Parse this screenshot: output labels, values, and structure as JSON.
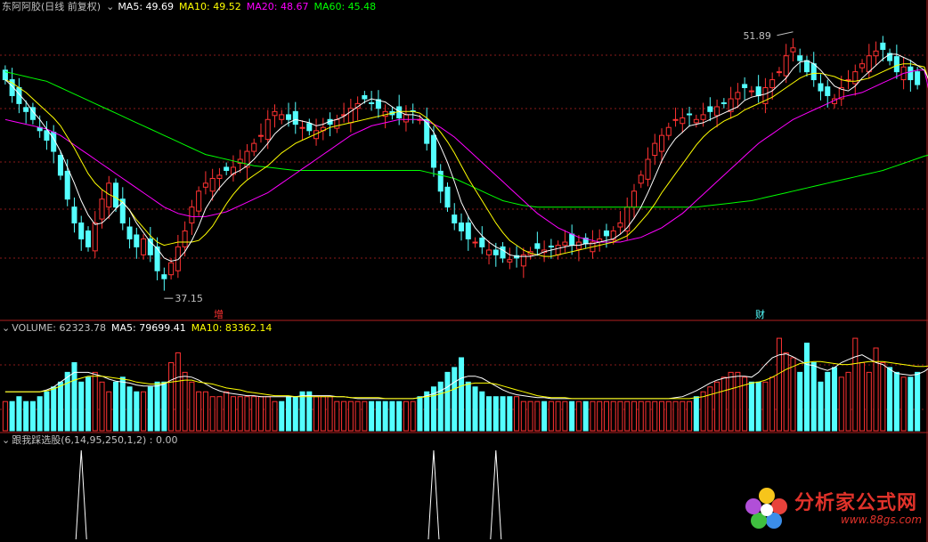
{
  "colors": {
    "up": "#ff3232",
    "down": "#54ffff",
    "ma5": "#ffffff",
    "ma10": "#ffff00",
    "ma20": "#ff00ff",
    "ma60": "#00ff00",
    "grid": "#8a1a1a",
    "divider": "#b02020",
    "text": "#c0c0c0"
  },
  "price_header": {
    "toggle_icon": "circle-chevron-icon",
    "title": "东阿阿胶(日线 前复权)",
    "ma5": "MA5: 49.69",
    "ma10": "MA10: 49.52",
    "ma20": "MA20: 48.67",
    "ma60": "MA60: 45.48"
  },
  "volume_header": {
    "toggle_icon": "circle-chevron-icon",
    "title": "VOLUME: 62323.78",
    "ma5": "MA5: 79699.41",
    "ma10": "MA10: 83362.14"
  },
  "indicator_header": {
    "toggle_icon": "circle-chevron-icon",
    "title": "跟我踩选股(6,14,95,250,1,2) : 0.00"
  },
  "markers": {
    "zeng": "增",
    "cai": "财"
  },
  "watermark": {
    "text": "分析家公式网",
    "url": "www.88gs.com"
  },
  "chart_data": [
    {
      "type": "candlestick",
      "title": "东阿阿胶(日线 前复权)",
      "annotations": [
        {
          "label": "37.15",
          "kind": "low"
        },
        {
          "label": "51.89",
          "kind": "high"
        }
      ],
      "ylim": [
        36,
        54
      ],
      "close": [
        50,
        49,
        48.5,
        48,
        47.5,
        46.8,
        46.2,
        45.5,
        44,
        42.5,
        41,
        40,
        39.5,
        41,
        42.5,
        43.5,
        42,
        41,
        40,
        39.5,
        40,
        39,
        38,
        37.5,
        38.5,
        39.5,
        40.5,
        42,
        43,
        43.5,
        43.8,
        44,
        44.3,
        44.5,
        45,
        45.5,
        46,
        46.5,
        47.5,
        48,
        47.8,
        47.5,
        47.2,
        47,
        46.8,
        46.8,
        47,
        47.2,
        47.5,
        47.8,
        48.2,
        48.5,
        48.8,
        48.5,
        48.2,
        48,
        47.8,
        47.6,
        47.8,
        48,
        47.5,
        46,
        44.5,
        43,
        42,
        41,
        40.5,
        40,
        39.8,
        39.5,
        39.3,
        39,
        38.8,
        38.7,
        38.8,
        39,
        39.2,
        39.4,
        39.3,
        39.5,
        39.6,
        39.8,
        39.6,
        39.8,
        39.7,
        39.8,
        40,
        40.2,
        40.5,
        41,
        42,
        43,
        44,
        45,
        46,
        46.5,
        47,
        47.5,
        47.6,
        47.8,
        47.5,
        47.8,
        48,
        48.3,
        48.5,
        48.8,
        49.2,
        49.5,
        49.3,
        49,
        49.5,
        50,
        50.5,
        51.5,
        52,
        51.2,
        50.5,
        50,
        49.3,
        49,
        48.8,
        49.5,
        50,
        50.5,
        51,
        51.5,
        51.8,
        51.9,
        51.2,
        50.5,
        50.8,
        50,
        49.69
      ],
      "ma5": [
        50,
        49.6,
        49.1,
        48.6,
        48,
        47.5,
        46.9,
        46.3,
        45.5,
        44.5,
        43.5,
        42.4,
        41.5,
        40.9,
        41,
        41.4,
        41.9,
        42.3,
        41.8,
        41,
        40.4,
        39.8,
        39.4,
        38.8,
        38.6,
        38.7,
        39.2,
        39.9,
        40.8,
        41.9,
        42.6,
        43.2,
        43.7,
        44.1,
        44.3,
        44.6,
        45,
        45.5,
        46,
        46.6,
        47,
        47.3,
        47.5,
        47.4,
        47.3,
        47.1,
        47.2,
        47.4,
        47.5,
        47.7,
        48,
        48.3,
        48.6,
        48.8,
        48.7,
        48.6,
        48.3,
        48,
        47.8,
        47.8,
        47.7,
        47.3,
        46.7,
        45.8,
        44.8,
        43.6,
        42.3,
        41.4,
        40.7,
        40.2,
        39.8,
        39.5,
        39.3,
        39,
        38.9,
        38.9,
        38.9,
        39,
        39.2,
        39.3,
        39.4,
        39.5,
        39.6,
        39.6,
        39.7,
        39.7,
        39.8,
        39.9,
        40,
        40.3,
        40.7,
        41.3,
        42,
        42.9,
        43.9,
        44.9,
        45.7,
        46.3,
        46.7,
        47.1,
        47.2,
        47.3,
        47.5,
        47.7,
        47.9,
        48.1,
        48.3,
        48.7,
        48.9,
        49,
        49.1,
        49.3,
        49.7,
        50.1,
        50.7,
        51.1,
        51.2,
        51,
        50.6,
        50.1,
        49.6,
        49.4,
        49.3,
        49.6,
        50.1,
        50.5,
        50.9,
        51.3,
        51.6,
        51.6,
        51.4,
        51.2,
        50.9,
        50.6,
        49.69
      ],
      "ma10": [
        50,
        49.8,
        49.5,
        49.2,
        48.8,
        48.4,
        48,
        47.6,
        47.1,
        46.4,
        45.7,
        44.9,
        44.1,
        43.5,
        43.1,
        42.8,
        42.6,
        42.3,
        41.8,
        41.2,
        40.7,
        40.2,
        39.8,
        39.6,
        39.7,
        39.8,
        39.8,
        39.8,
        39.9,
        40.3,
        40.8,
        41.5,
        42.2,
        42.8,
        43.3,
        43.7,
        44,
        44.3,
        44.6,
        45,
        45.4,
        45.7,
        46,
        46.2,
        46.4,
        46.6,
        46.8,
        47,
        47.1,
        47.2,
        47.3,
        47.4,
        47.5,
        47.6,
        47.7,
        47.8,
        47.9,
        48,
        48,
        48,
        47.9,
        47.6,
        47.2,
        46.7,
        46.1,
        45.4,
        44.6,
        43.8,
        43.1,
        42.4,
        41.7,
        41,
        40.4,
        39.9,
        39.6,
        39.3,
        39.1,
        39,
        38.9,
        38.9,
        39,
        39.1,
        39.2,
        39.3,
        39.4,
        39.5,
        39.6,
        39.7,
        39.8,
        40,
        40.2,
        40.6,
        41.1,
        41.6,
        42.2,
        42.9,
        43.5,
        44.1,
        44.7,
        45.3,
        45.9,
        46.4,
        46.8,
        47.1,
        47.4,
        47.6,
        47.8,
        48.1,
        48.3,
        48.5,
        48.7,
        48.9,
        49.2,
        49.5,
        49.8,
        50.1,
        50.3,
        50.4,
        50.4,
        50.3,
        50.2,
        50,
        49.9,
        49.9,
        50,
        50.1,
        50.3,
        50.5,
        50.7,
        50.9,
        51,
        51,
        50.9,
        50.8,
        49.52
      ],
      "ma20": [
        47.5,
        47.4,
        47.3,
        47.2,
        47.1,
        47,
        46.9,
        46.7,
        46.5,
        46.2,
        45.9,
        45.6,
        45.3,
        45,
        44.7,
        44.4,
        44.1,
        43.8,
        43.5,
        43.2,
        42.9,
        42.6,
        42.3,
        42,
        41.8,
        41.6,
        41.5,
        41.4,
        41.4,
        41.4,
        41.5,
        41.6,
        41.7,
        41.9,
        42.1,
        42.3,
        42.5,
        42.7,
        42.9,
        43.2,
        43.5,
        43.8,
        44.1,
        44.4,
        44.7,
        45,
        45.3,
        45.6,
        45.9,
        46.2,
        46.5,
        46.7,
        46.9,
        47.1,
        47.2,
        47.3,
        47.4,
        47.5,
        47.5,
        47.5,
        47.5,
        47.4,
        47.2,
        47,
        46.7,
        46.4,
        46,
        45.6,
        45.2,
        44.8,
        44.4,
        44,
        43.6,
        43.2,
        42.8,
        42.4,
        42,
        41.6,
        41.3,
        41,
        40.7,
        40.5,
        40.3,
        40.1,
        40,
        39.9,
        39.8,
        39.8,
        39.8,
        39.8,
        39.9,
        40,
        40.1,
        40.3,
        40.5,
        40.7,
        41,
        41.3,
        41.6,
        42,
        42.4,
        42.8,
        43.2,
        43.6,
        44,
        44.4,
        44.8,
        45.2,
        45.6,
        46,
        46.3,
        46.6,
        46.9,
        47.2,
        47.5,
        47.7,
        47.9,
        48.1,
        48.3,
        48.5,
        48.7,
        48.9,
        49,
        49.1,
        49.2,
        49.4,
        49.6,
        49.8,
        50,
        50.2,
        50.4,
        50.5,
        50.6,
        50.6,
        48.67
      ],
      "ma60": [
        50.5,
        50.4,
        50.3,
        50.2,
        50.1,
        50,
        49.9,
        49.7,
        49.5,
        49.3,
        49.1,
        48.9,
        48.7,
        48.5,
        48.3,
        48.1,
        47.9,
        47.7,
        47.5,
        47.3,
        47.1,
        46.9,
        46.7,
        46.5,
        46.3,
        46.1,
        45.9,
        45.7,
        45.5,
        45.3,
        45.2,
        45.1,
        45,
        44.9,
        44.8,
        44.7,
        44.6,
        44.55,
        44.5,
        44.45,
        44.4,
        44.35,
        44.3,
        44.3,
        44.3,
        44.3,
        44.3,
        44.3,
        44.3,
        44.3,
        44.3,
        44.3,
        44.3,
        44.3,
        44.3,
        44.3,
        44.3,
        44.3,
        44.3,
        44.3,
        44.3,
        44.2,
        44.1,
        44,
        43.9,
        43.8,
        43.6,
        43.4,
        43.2,
        43,
        42.8,
        42.6,
        42.4,
        42.3,
        42.2,
        42.1,
        42.05,
        42,
        42,
        42,
        42,
        42,
        42,
        42,
        42,
        42,
        42,
        42,
        42,
        42,
        42,
        42,
        42,
        42,
        42,
        42,
        42,
        42,
        42,
        42,
        42,
        42.05,
        42.1,
        42.15,
        42.2,
        42.25,
        42.3,
        42.35,
        42.4,
        42.5,
        42.6,
        42.7,
        42.8,
        42.9,
        43,
        43.1,
        43.2,
        43.3,
        43.4,
        43.5,
        43.6,
        43.7,
        43.8,
        43.9,
        44,
        44.1,
        44.2,
        44.3,
        44.45,
        44.6,
        44.75,
        44.9,
        45.05,
        45.2,
        45.3,
        45.4,
        45.48
      ]
    },
    {
      "type": "bar",
      "title": "VOLUME: 62323.78",
      "volume": [
        3,
        3,
        3.5,
        3,
        3,
        3.5,
        4,
        4.5,
        5,
        6,
        7,
        5,
        5.5,
        6,
        5,
        4,
        5,
        5.5,
        4.5,
        4,
        4,
        4.5,
        5,
        5,
        7,
        8,
        6,
        5,
        4,
        4,
        3.5,
        3.5,
        4,
        3.5,
        3.5,
        3.5,
        3.5,
        3.5,
        3.5,
        3,
        3,
        3.5,
        3.5,
        4,
        4,
        3.5,
        3.5,
        3.5,
        3,
        3,
        3,
        3,
        3,
        3,
        3,
        3,
        3,
        3,
        3,
        3,
        3.5,
        4,
        4.5,
        5,
        6,
        6.5,
        7.5,
        5,
        4.5,
        4,
        3.5,
        3.5,
        3.5,
        3.5,
        3.5,
        3,
        3,
        3,
        3,
        3,
        3,
        3,
        3,
        3,
        3,
        3,
        3,
        3,
        3,
        3,
        3,
        3,
        3,
        3,
        3,
        3,
        3,
        3,
        3,
        3,
        3.5,
        4,
        4.5,
        5,
        5.5,
        6,
        6,
        5.5,
        5,
        5,
        5,
        5.5,
        9.5,
        8,
        7.5,
        6,
        9,
        7,
        5,
        6,
        6.5,
        5.5,
        6,
        9.5,
        7,
        6,
        8.5,
        7,
        6.5,
        6,
        5.5,
        5.5,
        6,
        5.5,
        5.5,
        6,
        5.5,
        8,
        9,
        8.5,
        7,
        6.5
      ],
      "ma5": [
        4,
        4,
        4,
        4,
        4,
        4,
        4.2,
        4.5,
        5,
        5.5,
        6,
        6,
        6,
        5.8,
        5.6,
        5.3,
        5.1,
        5,
        4.9,
        4.7,
        4.6,
        4.6,
        4.6,
        4.8,
        5.2,
        5.5,
        5.6,
        5.5,
        5.2,
        4.8,
        4.4,
        4.1,
        3.9,
        3.8,
        3.7,
        3.6,
        3.6,
        3.5,
        3.5,
        3.5,
        3.5,
        3.5,
        3.5,
        3.6,
        3.6,
        3.6,
        3.6,
        3.6,
        3.5,
        3.5,
        3.4,
        3.3,
        3.3,
        3.3,
        3.3,
        3.3,
        3.3,
        3.3,
        3.3,
        3.3,
        3.4,
        3.6,
        3.8,
        4.1,
        4.5,
        5,
        5.4,
        5.6,
        5.6,
        5.4,
        5,
        4.6,
        4.2,
        3.9,
        3.7,
        3.6,
        3.5,
        3.4,
        3.4,
        3.3,
        3.3,
        3.3,
        3.3,
        3.3,
        3.3,
        3.3,
        3.3,
        3.3,
        3.3,
        3.3,
        3.3,
        3.3,
        3.3,
        3.3,
        3.3,
        3.3,
        3.3,
        3.4,
        3.5,
        3.8,
        4.1,
        4.5,
        4.9,
        5.2,
        5.4,
        5.5,
        5.6,
        5.6,
        5.5,
        6,
        6.8,
        7.5,
        7.8,
        7.9,
        7.6,
        7.2,
        6.8,
        6.7,
        6.4,
        6.2,
        6.5,
        7,
        7.3,
        7.6,
        7.8,
        7.4,
        7,
        6.8,
        6.3,
        5.9,
        5.8,
        5.7,
        5.8,
        6.1,
        6.6,
        7.2,
        7.7,
        8,
        7.96
      ],
      "ma10": [
        4,
        4,
        4,
        4,
        4,
        4,
        4.1,
        4.3,
        4.6,
        4.9,
        5.2,
        5.4,
        5.6,
        5.6,
        5.6,
        5.5,
        5.4,
        5.3,
        5.2,
        5,
        4.9,
        4.8,
        4.8,
        4.9,
        5,
        5.1,
        5.2,
        5.2,
        5,
        4.9,
        4.8,
        4.6,
        4.4,
        4.3,
        4.2,
        4,
        3.9,
        3.8,
        3.7,
        3.6,
        3.6,
        3.6,
        3.5,
        3.5,
        3.5,
        3.5,
        3.5,
        3.5,
        3.5,
        3.5,
        3.4,
        3.4,
        3.4,
        3.4,
        3.4,
        3.3,
        3.3,
        3.3,
        3.3,
        3.3,
        3.4,
        3.5,
        3.6,
        3.8,
        4,
        4.3,
        4.6,
        4.8,
        4.9,
        4.9,
        4.9,
        4.8,
        4.6,
        4.4,
        4.2,
        4,
        3.8,
        3.6,
        3.5,
        3.4,
        3.4,
        3.4,
        3.3,
        3.3,
        3.3,
        3.3,
        3.3,
        3.3,
        3.3,
        3.3,
        3.3,
        3.3,
        3.3,
        3.3,
        3.3,
        3.3,
        3.3,
        3.3,
        3.3,
        3.3,
        3.4,
        3.5,
        3.7,
        3.9,
        4.1,
        4.3,
        4.5,
        4.7,
        4.9,
        5,
        5.2,
        5.5,
        5.9,
        6.3,
        6.6,
        6.9,
        7,
        7.1,
        7.1,
        7,
        6.9,
        6.8,
        6.8,
        6.9,
        7,
        7.1,
        7.1,
        7.1,
        7,
        6.9,
        6.8,
        6.7,
        6.6,
        6.6,
        6.7,
        6.9,
        7,
        7.1,
        7.2,
        8.34
      ]
    },
    {
      "type": "line",
      "title": "跟我踩选股(6,14,95,250,1,2) : 0.00",
      "signal_spikes_at_bar": [
        11,
        62,
        71
      ],
      "signal_value": 1
    }
  ]
}
